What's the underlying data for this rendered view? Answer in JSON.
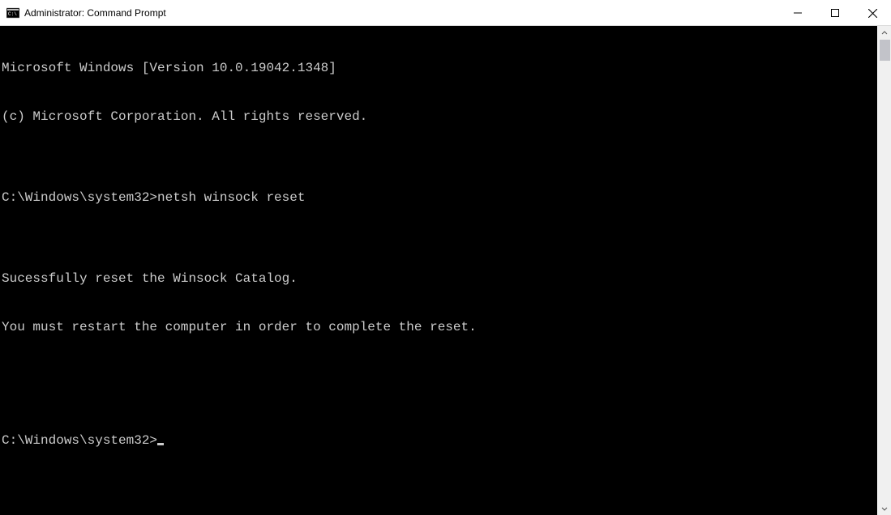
{
  "window": {
    "title": "Administrator: Command Prompt"
  },
  "terminal": {
    "lines": [
      "Microsoft Windows [Version 10.0.19042.1348]",
      "(c) Microsoft Corporation. All rights reserved.",
      "",
      "C:\\Windows\\system32>netsh winsock reset",
      "",
      "Sucessfully reset the Winsock Catalog.",
      "You must restart the computer in order to complete the reset.",
      "",
      ""
    ],
    "prompt": "C:\\Windows\\system32>"
  }
}
